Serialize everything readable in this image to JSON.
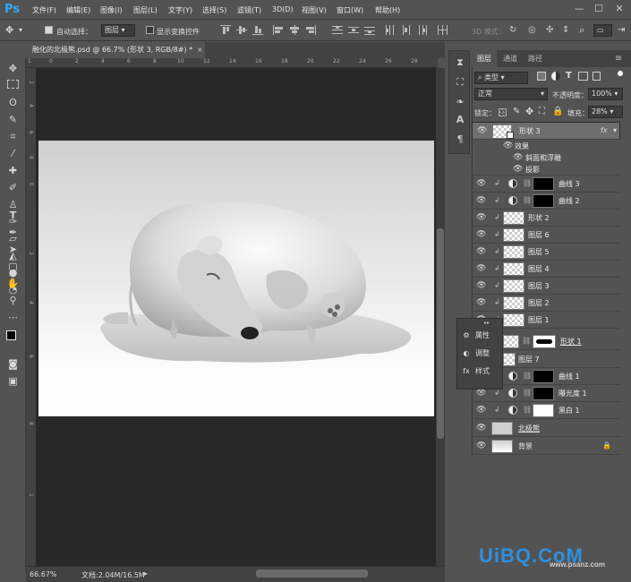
{
  "app": {
    "logo": "Ps"
  },
  "menu": [
    "文件(F)",
    "编辑(E)",
    "图像(I)",
    "图层(L)",
    "文字(Y)",
    "选择(S)",
    "滤镜(T)",
    "3D(D)",
    "视图(V)",
    "窗口(W)",
    "帮助(H)"
  ],
  "window_controls": {
    "minimize": "—",
    "maximize": "☐",
    "close": "✕"
  },
  "options": {
    "auto_select_label": "自动选择：",
    "auto_select_target": "图层",
    "show_transform_label": "显示变换控件",
    "mode3d": "3D 模式："
  },
  "document": {
    "tab_title": "融化的北极熊.psd @ 66.7% (形状 3, RGB/8#) *",
    "close_glyph": "×"
  },
  "ruler_h": [
    "1",
    "0",
    "2",
    "4",
    "6",
    "8",
    "10",
    "12",
    "14",
    "16",
    "18",
    "20",
    "22",
    "24",
    "26",
    "28"
  ],
  "ruler_v": [
    "2",
    "4",
    "6",
    "8",
    "0",
    "2",
    "4",
    "6",
    "8",
    "1"
  ],
  "status": {
    "zoom": "66.67%",
    "doc": "文档:2.04M/16.5M"
  },
  "panel": {
    "tabs": [
      "图层",
      "通道",
      "路径"
    ],
    "filter_kind": "类型",
    "blend_mode": "正常",
    "opacity_label": "不透明度：",
    "opacity_value": "100%",
    "lock_label": "锁定：",
    "fill_label": "填充：",
    "fill_value": "28%"
  },
  "layers": [
    {
      "name": "形状 3",
      "fx": "fx"
    },
    {
      "name": "效果"
    },
    {
      "name": "斜面和浮雕"
    },
    {
      "name": "投影"
    },
    {
      "name": "曲线 3"
    },
    {
      "name": "曲线 2"
    },
    {
      "name": "形状 2"
    },
    {
      "name": "图层 6"
    },
    {
      "name": "图层 5"
    },
    {
      "name": "图层 4"
    },
    {
      "name": "图层 3"
    },
    {
      "name": "图层 2"
    },
    {
      "name": "图层 1"
    },
    {
      "name": "形状 1"
    },
    {
      "name": "图层 7"
    },
    {
      "name": "曲线 1"
    },
    {
      "name": "曝光度 1"
    },
    {
      "name": "黑白 1"
    },
    {
      "name": "北极熊"
    },
    {
      "name": "背景"
    }
  ],
  "mini_panel": {
    "collapse": "▸▸",
    "items": [
      "属性",
      "调整",
      "样式"
    ]
  },
  "watermark": {
    "brand": "UiBQ.CoM",
    "site": "www.psanz.com"
  }
}
